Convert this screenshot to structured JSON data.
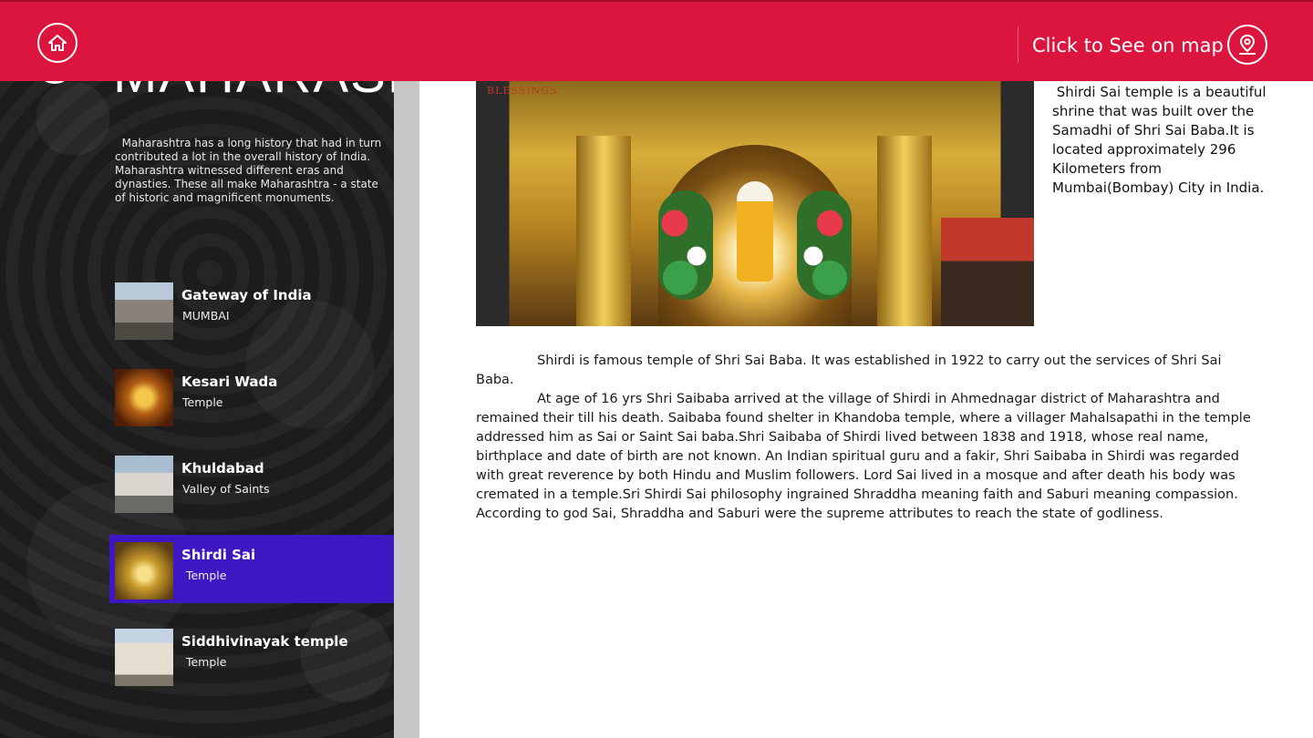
{
  "header": {
    "map_link_label": "Click to See on map",
    "home_icon": "home-icon",
    "map_icon": "map-pin-icon"
  },
  "sidebar": {
    "region_title": "MAHARASHTRA",
    "region_description": "  Maharashtra has a long history that had in turn contributed a lot in the overall history of India. Maharashtra witnessed different eras and dynasties. These all make Maharashtra - a state of historic and magnificent monuments.",
    "items": [
      {
        "name": "Gateway of India",
        "subtitle": "MUMBAI",
        "selected": false
      },
      {
        "name": "Kesari Wada",
        "subtitle": "Temple",
        "selected": false
      },
      {
        "name": "Khuldabad",
        "subtitle": "Valley of Saints",
        "selected": false
      },
      {
        "name": "Shirdi Sai",
        "subtitle": " Temple",
        "selected": true
      },
      {
        "name": "Siddhivinayak temple",
        "subtitle": " Temple",
        "selected": false
      }
    ]
  },
  "main": {
    "image_watermark": "BLESSINGS",
    "short_description": " Shirdi Sai temple is a beautiful shrine that was built over the Samadhi of Shri Sai Baba.It is located approximately 296 Kilometers from Mumbai(Bombay) City in India.",
    "paragraphs": [
      "Shirdi is famous temple of Shri Sai Baba. It was established in 1922 to carry out the services of Shri Sai Baba.",
      "At age of 16 yrs Shri Saibaba arrived at the village of Shirdi in Ahmednagar district of Maharashtra and remained their till his death. Saibaba found shelter in Khandoba temple, where a villager Mahalsapathi in the temple addressed him as Sai or Saint Sai baba.Shri Saibaba of Shirdi lived between 1838 and 1918, whose real name, birthplace and date of birth are not known. An Indian spiritual guru and a fakir, Shri Saibaba in Shirdi was regarded with great reverence by both Hindu and Muslim followers. Lord Sai lived in a mosque and after death his body was cremated in a temple.Sri Shirdi Sai philosophy ingrained Shraddha meaning faith and Saburi meaning compassion. According to god Sai, Shraddha and Saburi were the supreme attributes to reach the state of godliness."
    ]
  },
  "colors": {
    "header_bg": "#dc153f",
    "selected_bg": "#3d18c2",
    "sidebar_bg": "#1f1f1f"
  }
}
